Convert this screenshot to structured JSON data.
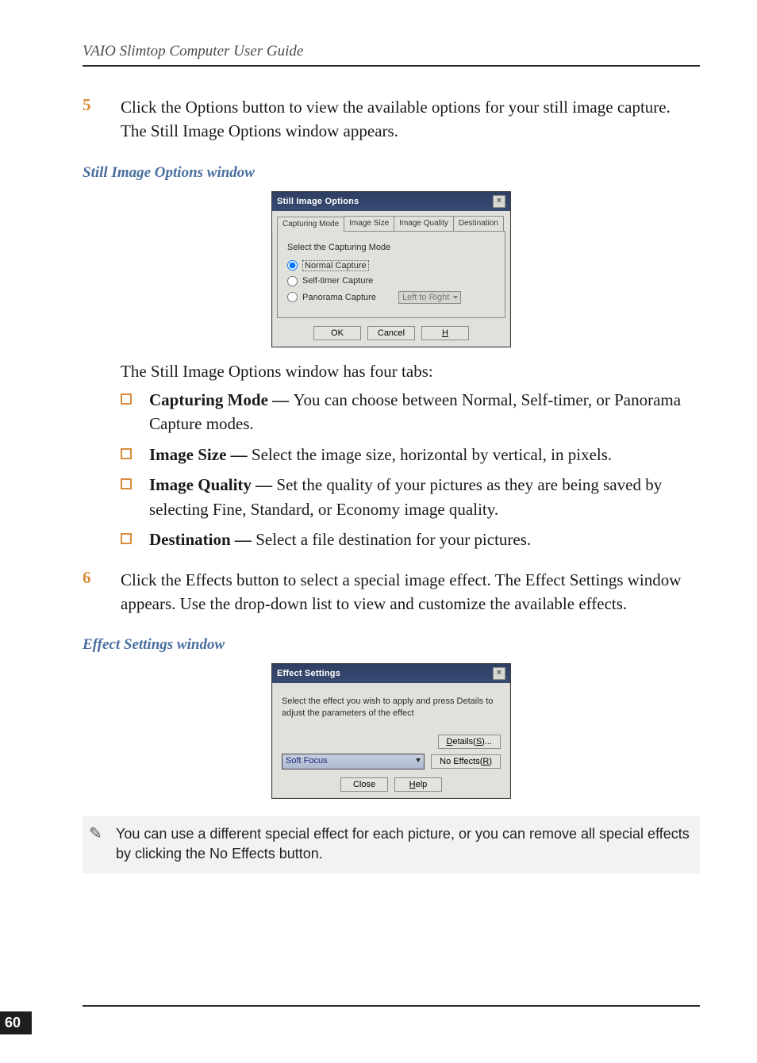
{
  "header": {
    "title": "VAIO Slimtop Computer User Guide"
  },
  "step5": {
    "number": "5",
    "text_line1": "Click the Options button to view the available options for your still image",
    "text_line2": "capture. The Still Image Options window appears."
  },
  "caption_still": "Still Image Options window",
  "dlg_still": {
    "title": "Still Image Options",
    "close": "×",
    "tabs": [
      "Capturing Mode",
      "Image Size",
      "Image Quality",
      "Destination"
    ],
    "prompt": "Select the Capturing Mode",
    "radio_normal": "Normal Capture",
    "radio_self": "Self-timer Capture",
    "radio_pan": "Panorama Capture",
    "pan_dir": "Left to Right",
    "btn_ok": "OK",
    "btn_cancel": "Cancel",
    "btn_help": "Help"
  },
  "intro_tabs": "The Still Image Options window has four tabs:",
  "bullets": {
    "capture_term": "Capturing Mode — ",
    "capture_desc": "You can choose between Normal, Self-timer, or Panorama Capture modes.",
    "size_term": "Image Size — ",
    "size_desc": "Select the image size, horizontal by vertical, in pixels.",
    "quality_term": "Image Quality — ",
    "quality_desc": "Set the quality of your pictures as they are being saved by selecting Fine, Standard, or Economy image quality.",
    "dest_term": "Destination — ",
    "dest_desc": "Select a file destination for your pictures."
  },
  "step6": {
    "number": "6",
    "text": "Click the Effects button to select a special image effect. The Effect Settings window appears. Use the drop-down list to view and customize the available effects."
  },
  "caption_effect": "Effect Settings window",
  "dlg_effect": {
    "title": "Effect Settings",
    "close": "×",
    "instructions": "Select the effect you wish to apply and press Details to adjust the parameters of the effect",
    "btn_details": "Details(S)...",
    "selected": "Soft Focus",
    "btn_noeffects": "No Effects(R)",
    "btn_close": "Close",
    "btn_help": "Help"
  },
  "note": "You can use a different special effect for each picture, or you can remove all special effects by clicking the No Effects button.",
  "page_number": "60",
  "chart_data": null
}
